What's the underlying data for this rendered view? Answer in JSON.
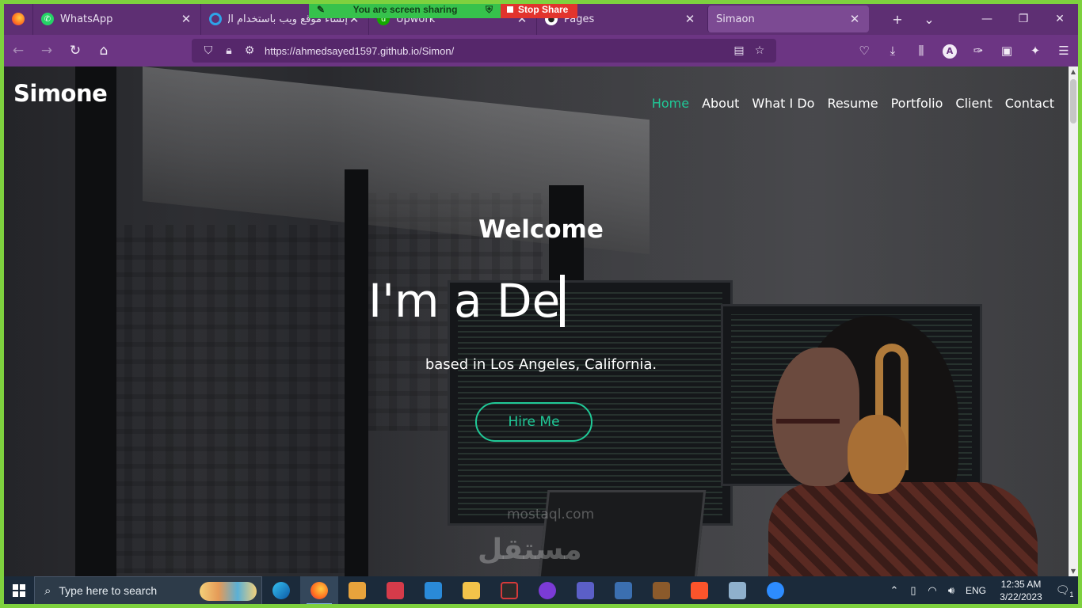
{
  "browser": {
    "tabs": [
      {
        "label": "WhatsApp",
        "icon": "whatsapp-icon",
        "color": "#25d366",
        "active": false
      },
      {
        "label": "إنشاء موقع ويب باستخدام ال",
        "icon": "loading-icon",
        "color": "#2ea3e8",
        "active": false
      },
      {
        "label": "Upwork",
        "icon": "upwork-icon",
        "color": "#14a800",
        "active": false
      },
      {
        "label": "Pages",
        "icon": "github-icon",
        "color": "#ffffff",
        "active": false
      },
      {
        "label": "Simaon",
        "icon": "",
        "color": "",
        "active": true
      }
    ],
    "url": "https://ahmedsayed1597.github.io/Simon/"
  },
  "screen_share": {
    "status": "You are screen sharing",
    "stop_label": "Stop Share"
  },
  "site": {
    "brand": "Simone",
    "nav": [
      "Home",
      "About",
      "What I Do",
      "Resume",
      "Portfolio",
      "Client",
      "Contact"
    ],
    "active_nav": "Home",
    "welcome": "Welcome",
    "typed_text": "I'm a De",
    "location": "based in Los Angeles, California.",
    "cta": "Hire Me",
    "accent_color": "#20c997"
  },
  "watermark": {
    "arabic": "مستقل",
    "latin": "mostaql.com"
  },
  "taskbar": {
    "search_placeholder": "Type here to search",
    "apps": [
      "edge-icon",
      "firefox-icon",
      "office-icon",
      "mail-icon",
      "vscode-icon",
      "file-explorer-icon",
      "pdf-icon",
      "game-icon",
      "teams-icon",
      "sql-icon",
      "minecraft-icon",
      "brave-icon",
      "remote-desktop-icon",
      "zoom-icon"
    ],
    "language": "ENG",
    "time": "12:35 AM",
    "date": "3/22/2023",
    "notifications": "1"
  }
}
